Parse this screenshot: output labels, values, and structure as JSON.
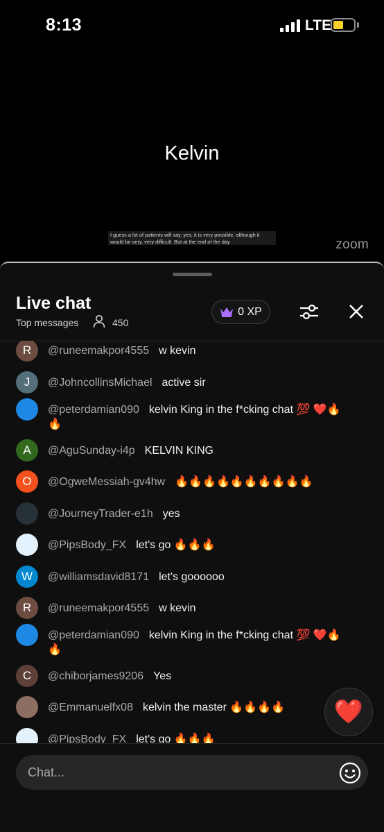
{
  "status_bar": {
    "time": "8:13",
    "network": "LTE"
  },
  "video": {
    "participant_name": "Kelvin",
    "caption": "I guess a lot of patients will say, yes, it is very possible, although it would be very, very difficult. But at the end of the day",
    "logo": "zoom"
  },
  "chat": {
    "title": "Live chat",
    "subtitle": "Top messages",
    "viewer_count": "450",
    "xp_label": "0 XP",
    "input_placeholder": "Chat...",
    "messages": [
      {
        "author": "@runeemakpor4555",
        "text": "w kevin",
        "avatar_letter": "R",
        "avatar_color": "#6d4c41"
      },
      {
        "author": "@JohncollinsMichael",
        "text": "active sir",
        "avatar_letter": "J",
        "avatar_color": "#546e7a"
      },
      {
        "author": "@peterdamian090",
        "text": "kelvin King in the f*cking chat 💯 ❤️🔥🔥",
        "avatar_letter": "",
        "avatar_color": "#1e88e5"
      },
      {
        "author": "@AguSunday-i4p",
        "text": "KELVIN KING",
        "avatar_letter": "A",
        "avatar_color": "#33691e"
      },
      {
        "author": "@OgweMessiah-gv4hw",
        "text": "🔥🔥🔥🔥🔥🔥🔥🔥🔥🔥",
        "avatar_letter": "O",
        "avatar_color": "#f4511e"
      },
      {
        "author": "@JourneyTrader-e1h",
        "text": "yes",
        "avatar_letter": "",
        "avatar_color": "#263238"
      },
      {
        "author": "@PipsBody_FX",
        "text": "let's go 🔥🔥🔥",
        "avatar_letter": "",
        "avatar_color": "#e3f2fd"
      },
      {
        "author": "@williamsdavid8171",
        "text": "let's goooooo",
        "avatar_letter": "W",
        "avatar_color": "#0288d1"
      },
      {
        "author": "@runeemakpor4555",
        "text": "w kevin",
        "avatar_letter": "R",
        "avatar_color": "#6d4c41"
      },
      {
        "author": "@peterdamian090",
        "text": "kelvin King in the f*cking chat 💯 ❤️🔥🔥",
        "avatar_letter": "",
        "avatar_color": "#1e88e5"
      },
      {
        "author": "@chiborjames9206",
        "text": "Yes",
        "avatar_letter": "C",
        "avatar_color": "#5d4037"
      },
      {
        "author": "@Emmanuelfx08",
        "text": "kelvin the master 🔥🔥🔥🔥",
        "avatar_letter": "",
        "avatar_color": "#8d6e63"
      },
      {
        "author": "@PipsBody_FX",
        "text": "let's go 🔥🔥🔥",
        "avatar_letter": "",
        "avatar_color": "#e3f2fd"
      }
    ]
  }
}
